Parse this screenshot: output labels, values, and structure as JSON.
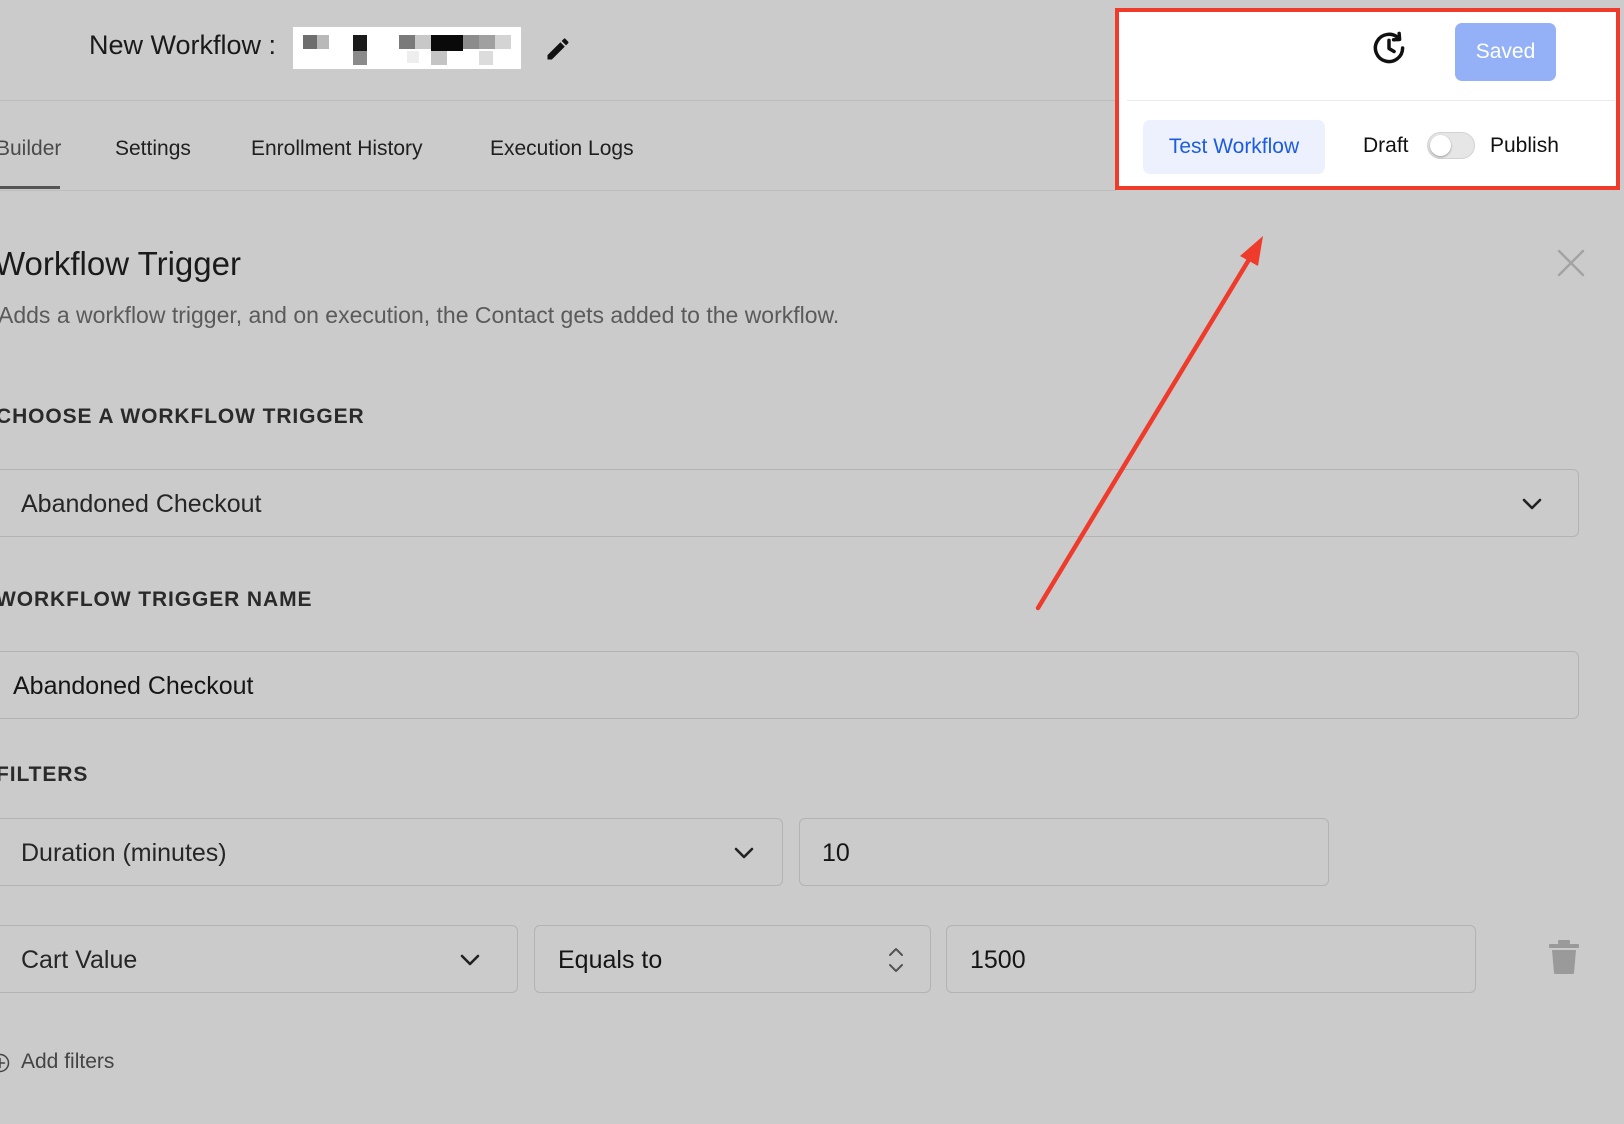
{
  "header": {
    "title": "New Workflow :",
    "name_redacted": true
  },
  "tabs": [
    {
      "label": "Builder",
      "active": true
    },
    {
      "label": "Settings",
      "active": false
    },
    {
      "label": "Enrollment History",
      "active": false
    },
    {
      "label": "Execution Logs",
      "active": false
    }
  ],
  "actions": {
    "history_icon": "history-icon",
    "saved_label": "Saved",
    "test_label": "Test Workflow",
    "draft_label": "Draft",
    "publish_label": "Publish",
    "published": false
  },
  "section": {
    "title": "Workflow Trigger",
    "description": "Adds a workflow trigger, and on execution, the Contact gets added to the workflow."
  },
  "form": {
    "choose_trigger_label": "CHOOSE A WORKFLOW TRIGGER",
    "trigger_value": "Abandoned Checkout",
    "trigger_name_label": "WORKFLOW TRIGGER NAME",
    "trigger_name_value": "Abandoned Checkout",
    "filters_label": "FILTERS",
    "filters": [
      {
        "field": "Duration (minutes)",
        "value": "10"
      },
      {
        "field": "Cart Value",
        "operator": "Equals to",
        "value": "1500"
      }
    ],
    "add_filters_label": "Add filters"
  },
  "colors": {
    "background": "#cbcbcb",
    "highlight_border": "#ef3b2c",
    "annotation_arrow": "#ef3b2c",
    "saved_button": "#94b1f8",
    "test_button_text": "#1d5ce0"
  }
}
